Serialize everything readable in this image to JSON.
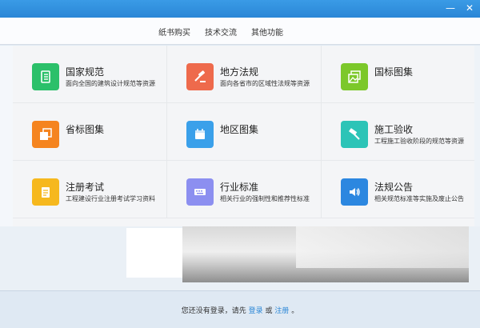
{
  "window": {
    "controls": [
      "—",
      "✕"
    ]
  },
  "nav": {
    "items": [
      "纸书购买",
      "技术交流",
      "其他功能"
    ]
  },
  "categories": [
    {
      "title": "国家规范",
      "desc": "面向全国的建筑设计规范等资源",
      "color": "#2bc06a",
      "icon": "document-icon"
    },
    {
      "title": "地方法规",
      "desc": "面向各省市的区域性法规等资源",
      "color": "#ee6a4c",
      "icon": "gavel-icon"
    },
    {
      "title": "国标图集",
      "desc": "",
      "color": "#7cc82a",
      "icon": "picture-icon"
    },
    {
      "title": "省标图集",
      "desc": "",
      "color": "#f5841f",
      "icon": "stack-icon"
    },
    {
      "title": "地区图集",
      "desc": "",
      "color": "#3aa0ea",
      "icon": "calendar-icon"
    },
    {
      "title": "施工验收",
      "desc": "工程施工验收阶段的规范等资源",
      "color": "#2cc4b7",
      "icon": "hammer-icon"
    },
    {
      "title": "注册考试",
      "desc": "工程建设行业注册考试学习资料",
      "color": "#f6b81e",
      "icon": "notepad-icon"
    },
    {
      "title": "行业标准",
      "desc": "相关行业的强制性和推荐性标准",
      "color": "#8c8ff0",
      "icon": "keyboard-icon"
    },
    {
      "title": "法规公告",
      "desc": "相关规范标准等实施及废止公告",
      "color": "#2c87e0",
      "icon": "speaker-icon"
    }
  ],
  "footer": {
    "prefix": "您还没有登录，请先",
    "login": "登录",
    "or": "或",
    "register": "注册",
    "suffix": "。"
  }
}
